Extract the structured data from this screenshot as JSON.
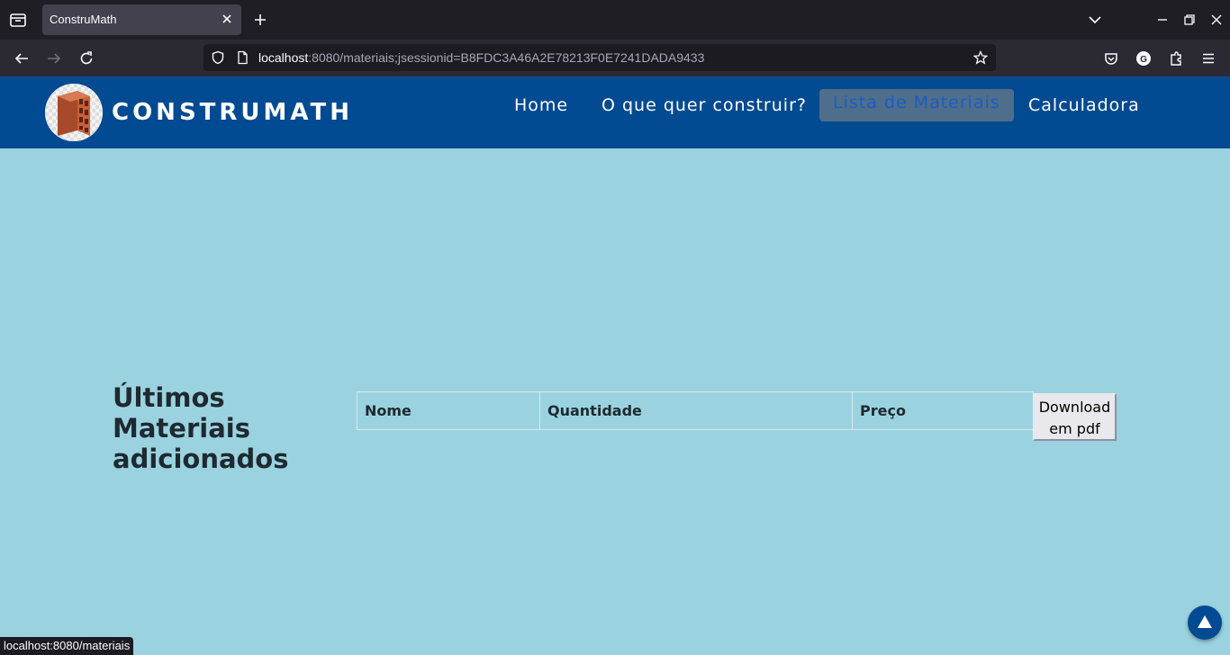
{
  "browser": {
    "tab_title": "ConstruMath",
    "url_host": "localhost",
    "url_rest": ":8080/materiais;jsessionid=B8FDC3A46A2E78213F0E7241DADA9433",
    "status_url": "localhost:8080/materiais",
    "icons": [
      "tab-list-icon",
      "close-icon",
      "plus-icon",
      "chevron-down-icon",
      "minimize-icon",
      "restore-icon",
      "close-window-icon",
      "back-icon",
      "forward-icon",
      "reload-icon",
      "shield-icon",
      "page-icon",
      "star-icon",
      "pocket-icon",
      "account-icon",
      "extensions-icon",
      "menu-icon"
    ]
  },
  "site": {
    "brand": "CONSTRUMATH",
    "nav": [
      {
        "label": "Home",
        "active": false
      },
      {
        "label": "O que quer construir?",
        "active": false
      },
      {
        "label": "Lista de Materiais",
        "active": true
      },
      {
        "label": "Calculadora",
        "active": false
      }
    ],
    "colors": {
      "header": "#024a92",
      "background": "#9ad3df",
      "active_nav_bg": "#4f6e8b",
      "active_nav_text": "#1a5ec4"
    }
  },
  "main": {
    "section_title": "Últimos Materiais adicionados",
    "table": {
      "columns": [
        "Nome",
        "Quantidade",
        "Preço"
      ],
      "rows": []
    },
    "download_button": "Download em pdf"
  }
}
